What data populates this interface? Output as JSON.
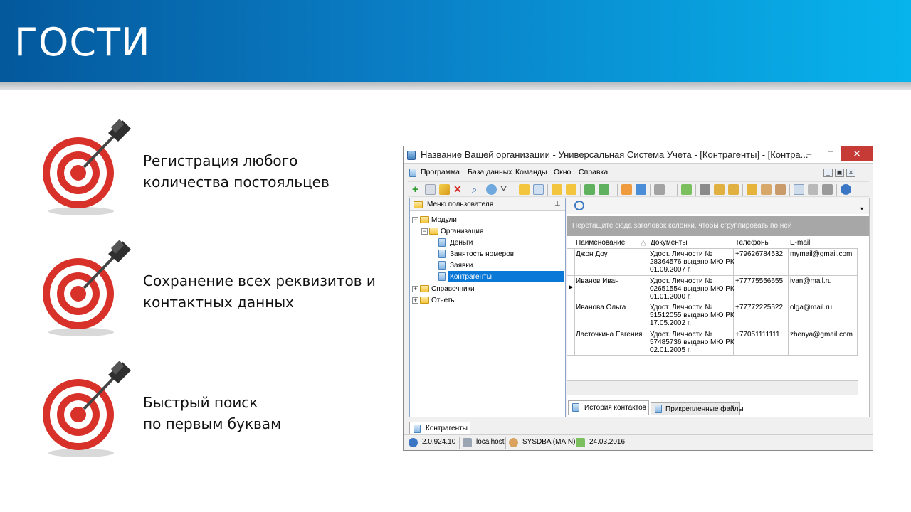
{
  "header": {
    "title": "ГОСТИ"
  },
  "features": [
    {
      "line1": "Регистрация любого",
      "line2": "количества постояльцев"
    },
    {
      "line1": "Сохранение всех реквизитов и",
      "line2": "контактных данных"
    },
    {
      "line1": "Быстрый поиск",
      "line2": "по первым буквам"
    }
  ],
  "window": {
    "title": "Название Вашей организации - Универсальная Система Учета - [Контрагенты] - [Контра...",
    "controls": {
      "minimize": "–",
      "maximize": "□",
      "close": "✕"
    },
    "menu": [
      "Программа",
      "База данных",
      "Команды",
      "Окно",
      "Справка"
    ],
    "user_menu": {
      "title": "Меню пользователя",
      "tree": {
        "modules": "Модули",
        "organization": "Организация",
        "items": [
          "Деньги",
          "Занятость номеров",
          "Заявки",
          "Контрагенты"
        ],
        "reference": "Справочники",
        "reports": "Отчеты"
      }
    },
    "grid": {
      "group_hint": "Перетащите сюда заголовок колонки, чтобы сгруппировать по ней",
      "columns": [
        "Наименование",
        "Документы",
        "Телефоны",
        "E-mail"
      ],
      "rows": [
        {
          "name": "Джон Доу",
          "doc1": "Удост. Личности №",
          "doc2": "28364576 выдано МЮ РК",
          "doc3": "01.09.2007 г.",
          "phone": "+79626784532",
          "email": "mymail@gmail.com"
        },
        {
          "name": "Иванов Иван",
          "doc1": "Удост. Личности №",
          "doc2": "02651554 выдано МЮ РК",
          "doc3": "01.01.2000 г.",
          "phone": "+77775556655",
          "email": "ivan@mail.ru"
        },
        {
          "name": "Иванова Ольга",
          "doc1": "Удост. Личности №",
          "doc2": "51512055 выдано МЮ РК",
          "doc3": "17.05.2002 г.",
          "phone": "+77772225522",
          "email": "olga@mail.ru"
        },
        {
          "name": "Ласточкина Евгения",
          "doc1": "Удост. Личности №",
          "doc2": "57485736 выдано МЮ РК",
          "doc3": "02.01.2005 г.",
          "phone": "+77051111111",
          "email": "zhenya@gmail.com"
        }
      ]
    },
    "detail_tabs": [
      "История контактов",
      "Прикрепленные файлы"
    ],
    "bottom_tab": "Контрагенты",
    "status": {
      "version": "2.0.924.10",
      "host": "localhost",
      "user": "SYSDBA (MAIN)",
      "date": "24.03.2016"
    }
  }
}
